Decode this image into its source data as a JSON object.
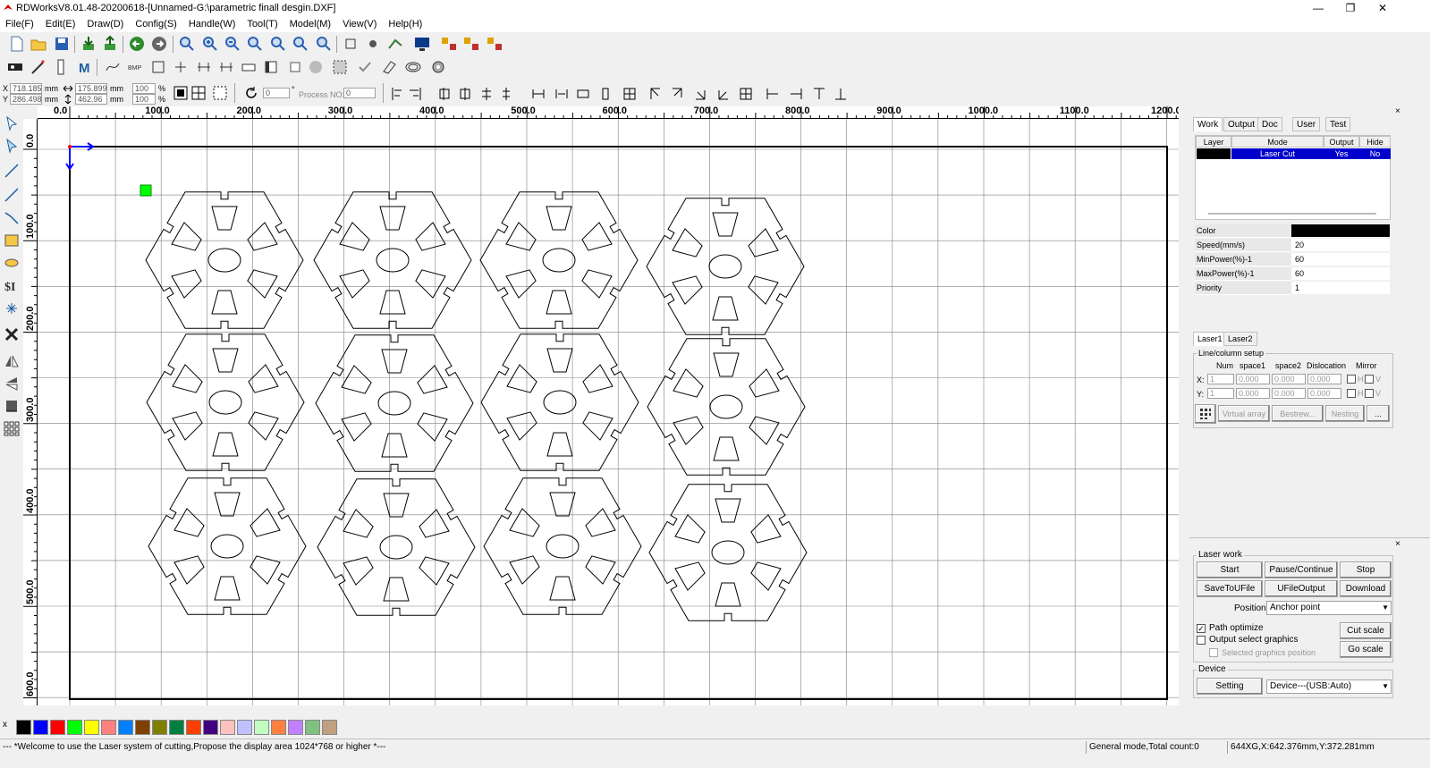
{
  "window": {
    "title": "RDWorksV8.01.48-20200618-[Unnamed-G:\\parametric finall desgin.DXF]",
    "minimize": "—",
    "restore": "❐",
    "close": "✕"
  },
  "menu": [
    "File(F)",
    "Edit(E)",
    "Draw(D)",
    "Config(S)",
    "Handle(W)",
    "Tool(T)",
    "Model(M)",
    "View(V)",
    "Help(H)"
  ],
  "coords": {
    "x_label": "X",
    "y_label": "Y",
    "x_value": "718.185",
    "y_value": "286.498",
    "unit": "mm",
    "width_value": "175.899",
    "height_value": "462.96",
    "scale_x": "100",
    "scale_y": "100",
    "percent": "%",
    "angle": "0",
    "degree": "°",
    "process_no_label": "Process NO:",
    "process_no": "0"
  },
  "ruler": {
    "top": [
      "0.0",
      "100.0",
      "200.0",
      "300.0",
      "400.0",
      "500.0",
      "600.0",
      "700.0",
      "800.0",
      "900.0",
      "1000.0",
      "1100.0",
      "1200.0"
    ],
    "left": [
      "0.0",
      "100.0",
      "200.0",
      "300.0",
      "400.0",
      "500.0",
      "600.0"
    ]
  },
  "right_panel": {
    "tabs": [
      "Work",
      "Output",
      "Doc",
      "User",
      "Test"
    ],
    "layer_headers": [
      "Layer",
      "Mode",
      "Output",
      "Hide"
    ],
    "layer_rows": [
      {
        "color": "#000000",
        "mode": "Laser Cut",
        "output": "Yes",
        "hide": "No"
      }
    ],
    "properties": [
      {
        "key": "Color",
        "value": ""
      },
      {
        "key": "Speed(mm/s)",
        "value": "20"
      },
      {
        "key": "MinPower(%)-1",
        "value": "60"
      },
      {
        "key": "MaxPower(%)-1",
        "value": "60"
      },
      {
        "key": "Priority",
        "value": "1"
      }
    ],
    "laser_tabs": [
      "Laser1",
      "Laser2"
    ],
    "line_column": {
      "title": "Line/column setup",
      "headers": [
        "Num",
        "space1",
        "space2",
        "Dislocation",
        "Mirror"
      ],
      "x_label": "X:",
      "y_label": "Y:",
      "x_row": [
        "1",
        "0.000",
        "0.000",
        "0.000"
      ],
      "y_row": [
        "1",
        "0.000",
        "0.000",
        "0.000"
      ],
      "mirror_h": "H",
      "mirror_v": "V",
      "buttons": [
        "Virtual array",
        "Bestrew...",
        "Nesting",
        "..."
      ]
    }
  },
  "laser_work": {
    "title": "Laser work",
    "buttons_row1": [
      "Start",
      "Pause/Continue",
      "Stop"
    ],
    "buttons_row2": [
      "SaveToUFile",
      "UFileOutput",
      "Download"
    ],
    "position_label": "Position:",
    "position_value": "Anchor point",
    "path_optimize": "Path optimize",
    "output_select": "Output select graphics",
    "selected_position": "Selected graphics position",
    "cut_scale": "Cut scale",
    "go_scale": "Go scale"
  },
  "device": {
    "title": "Device",
    "setting": "Setting",
    "device_value": "Device---(USB:Auto)"
  },
  "palette": [
    "#000000",
    "#0000ff",
    "#ff0000",
    "#00ff00",
    "#ffff00",
    "#ff8080",
    "#0080ff",
    "#804000",
    "#808000",
    "#008040",
    "#ff4000",
    "#400080",
    "#ffc0c0",
    "#c0c0ff",
    "#c0ffc0",
    "#ff8040",
    "#c080ff",
    "#80c080",
    "#c0a080"
  ],
  "palette_x": "x",
  "status": {
    "message": "--- *Welcome to use the Laser system of cutting,Propose the display area 1024*768 or higher *---",
    "mode": "General mode,Total count:0",
    "position": "644XG,X:642.376mm,Y:372.281mm"
  },
  "colors": {
    "selection_blue": "#0000ff",
    "marker_green": "#00ff00",
    "grid": "#808080"
  }
}
